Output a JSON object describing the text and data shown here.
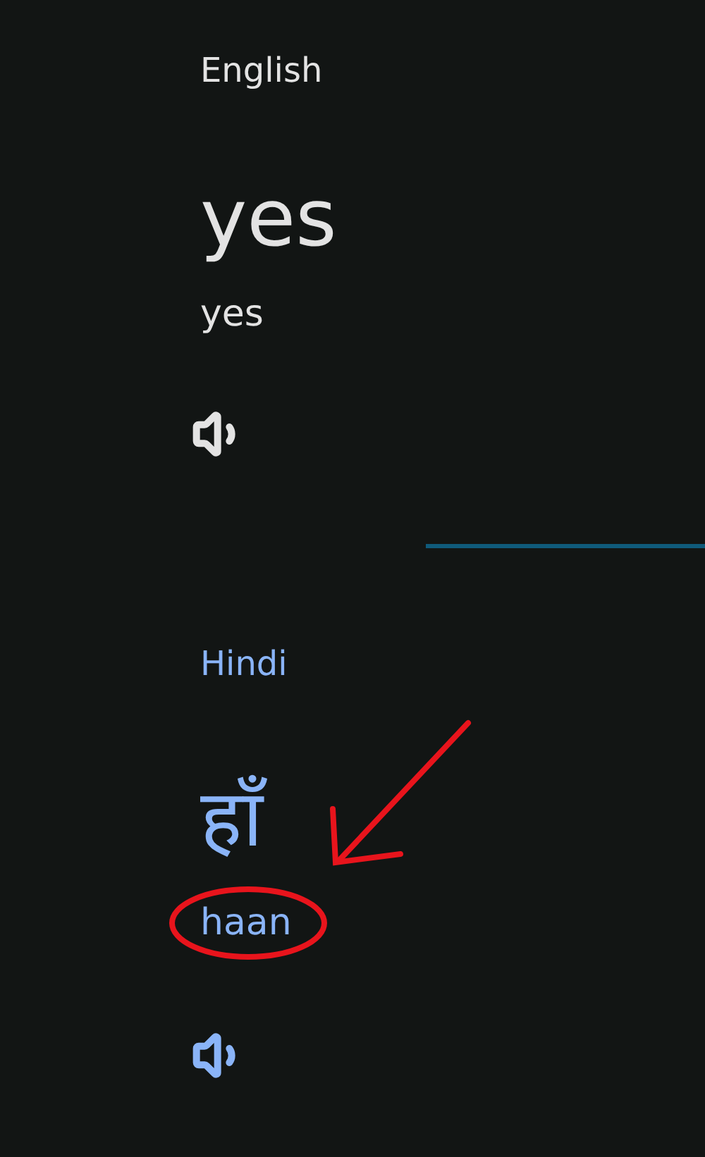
{
  "source": {
    "language": "English",
    "text": "yes",
    "transliteration": "yes"
  },
  "target": {
    "language": "Hindi",
    "text": "हाँ",
    "transliteration": "haan"
  },
  "annotations": {
    "arrow": true,
    "circle": true
  }
}
